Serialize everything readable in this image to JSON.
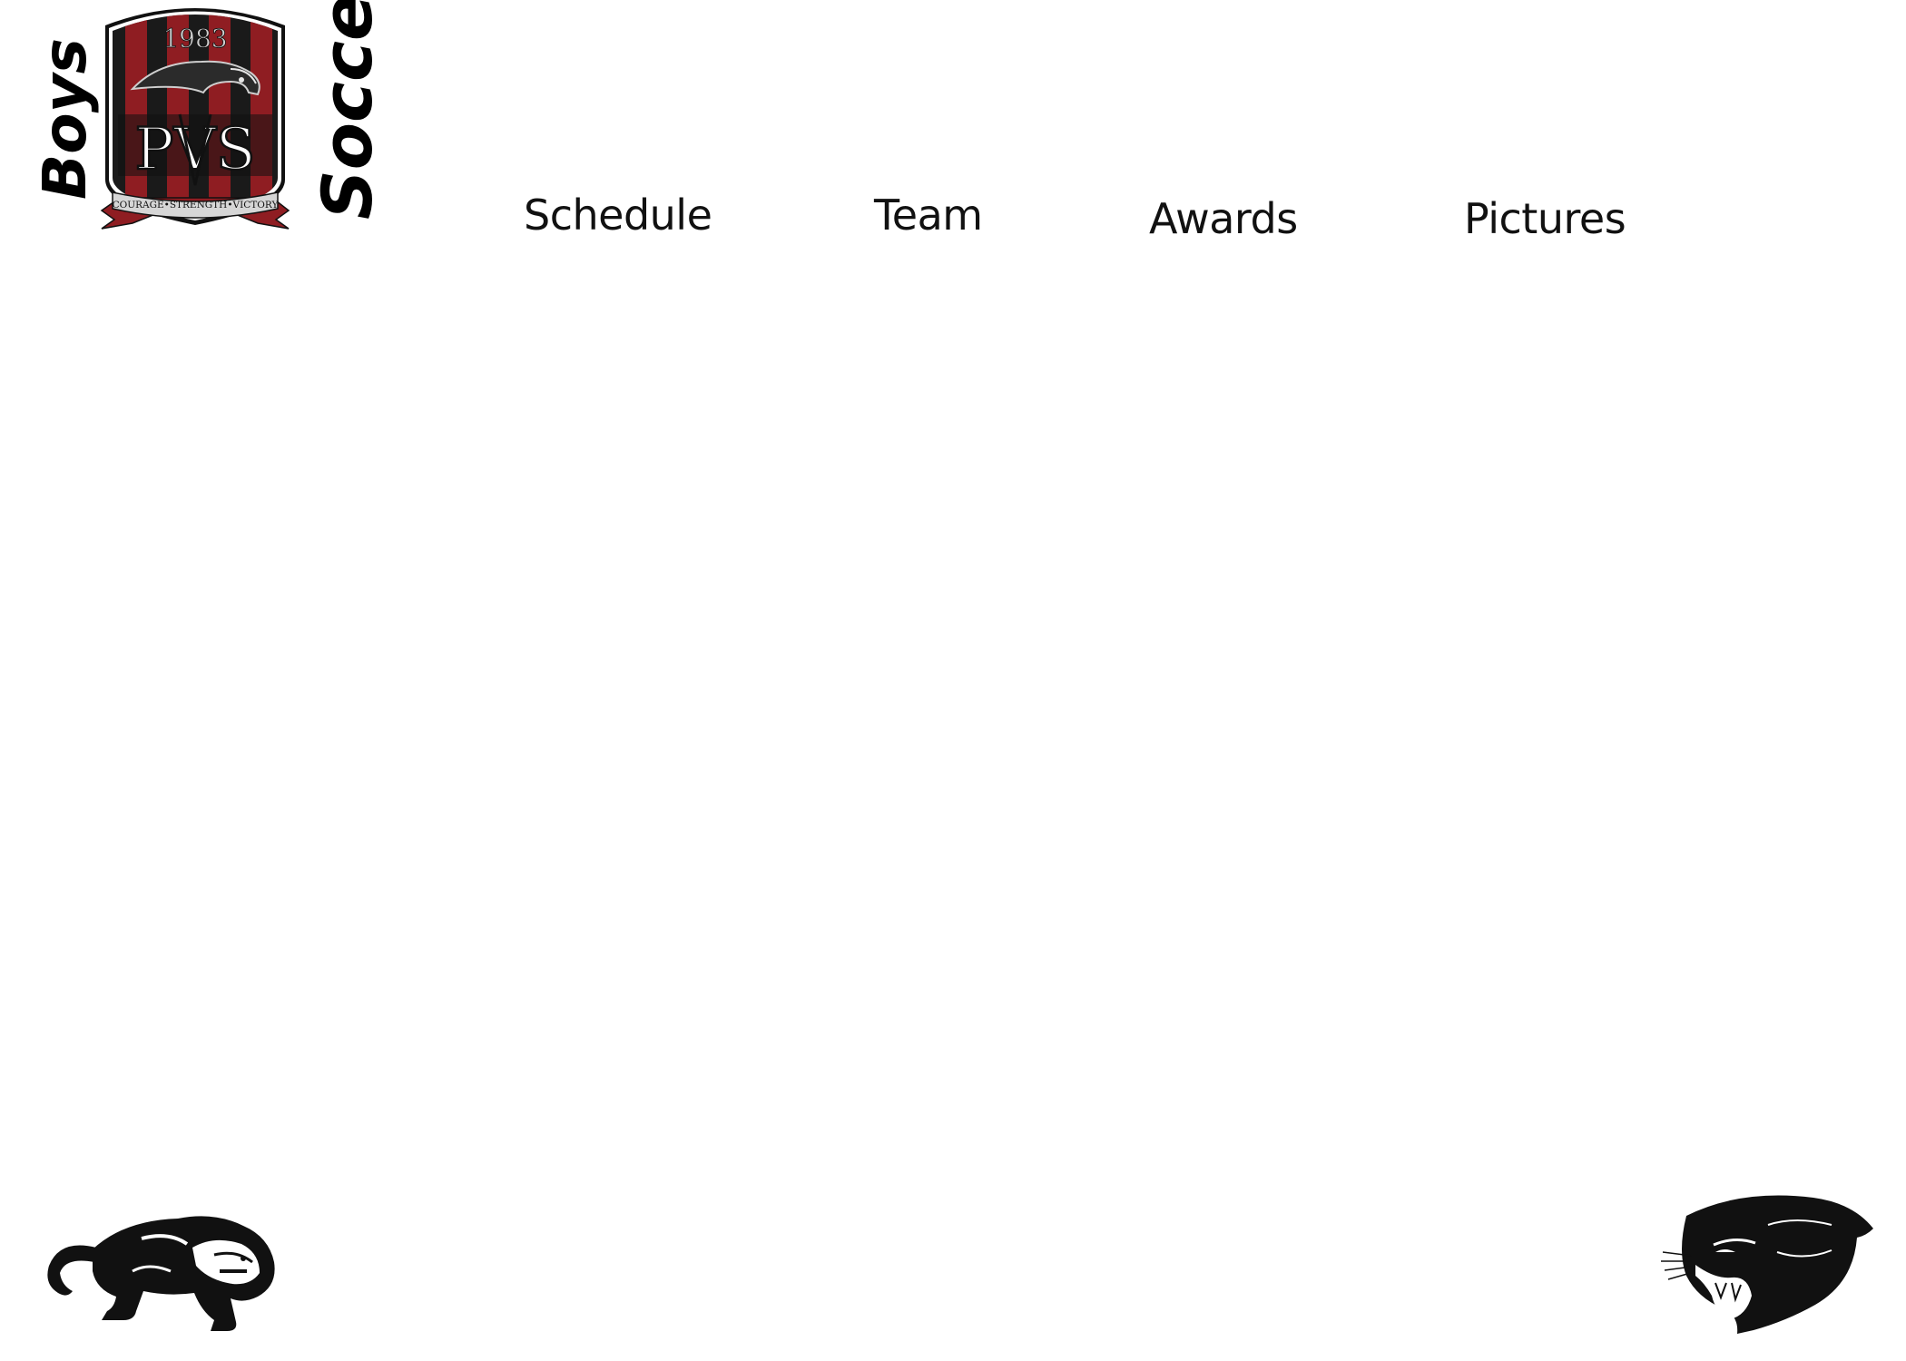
{
  "header": {
    "title_left": "Boys",
    "title_right": "Soccer",
    "crest": {
      "year": "1983",
      "initials": "PVS",
      "motto": "COURAGE•STRENGTH•VICTORY",
      "colors": {
        "red": "#8f1d22",
        "black": "#111111",
        "silver": "#bfbfbf"
      }
    }
  },
  "nav": {
    "items": [
      {
        "label": "Schedule"
      },
      {
        "label": "Team"
      },
      {
        "label": "Awards"
      },
      {
        "label": "Pictures"
      }
    ]
  },
  "decorations": {
    "left_image": "crouching-panther-icon",
    "right_image": "roaring-panther-head-icon"
  }
}
